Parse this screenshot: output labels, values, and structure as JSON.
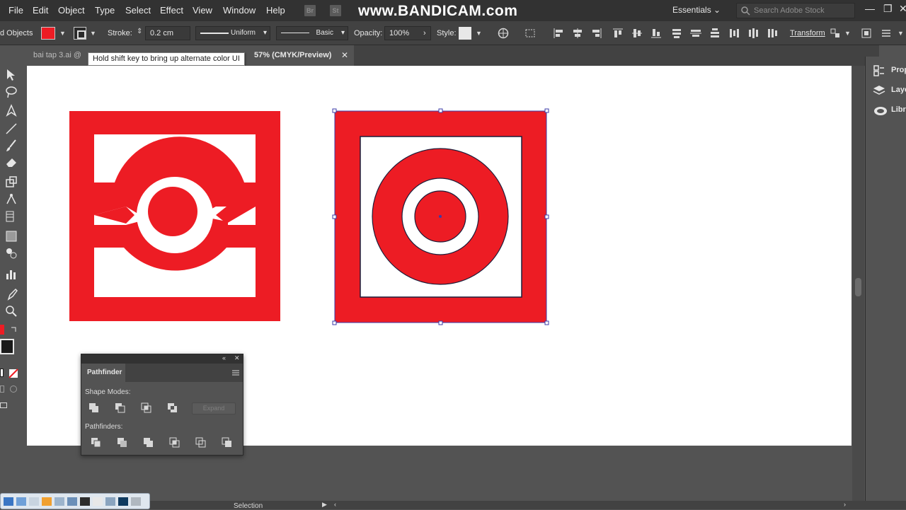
{
  "menu": {
    "items": [
      "File",
      "Edit",
      "Object",
      "Type",
      "Select",
      "Effect",
      "View",
      "Window",
      "Help"
    ],
    "app_chips": [
      "Br",
      "St"
    ],
    "watermark": "www.BANDICAM.com",
    "workspace": "Essentials",
    "search_placeholder": "Search Adobe Stock"
  },
  "control_bar": {
    "selection_label": "d Objects",
    "fill_color": "#ed1c24",
    "stroke_label": "Stroke:",
    "stroke_weight": "0.2 cm",
    "variable_width": "Uniform",
    "brush_profile": "Basic",
    "opacity_label": "Opacity:",
    "opacity_value": "100%",
    "style_label": "Style:",
    "transform_label": "Transform"
  },
  "document": {
    "tab_left": "bai tap 3.ai @",
    "tab_right": "57% (CMYK/Preview)",
    "tooltip": "Hold shift key to bring up alternate color UI"
  },
  "right_panel": {
    "items": [
      "Properties",
      "Layers",
      "Libraries"
    ]
  },
  "pathfinder": {
    "title": "Pathfinder",
    "shape_modes_label": "Shape Modes:",
    "pathfinders_label": "Pathfinders:",
    "expand_label": "Expand"
  },
  "artwork": {
    "accent_color": "#ed1c24",
    "selection_color": "#3b3ba8"
  },
  "status": {
    "tool": "Selection"
  }
}
